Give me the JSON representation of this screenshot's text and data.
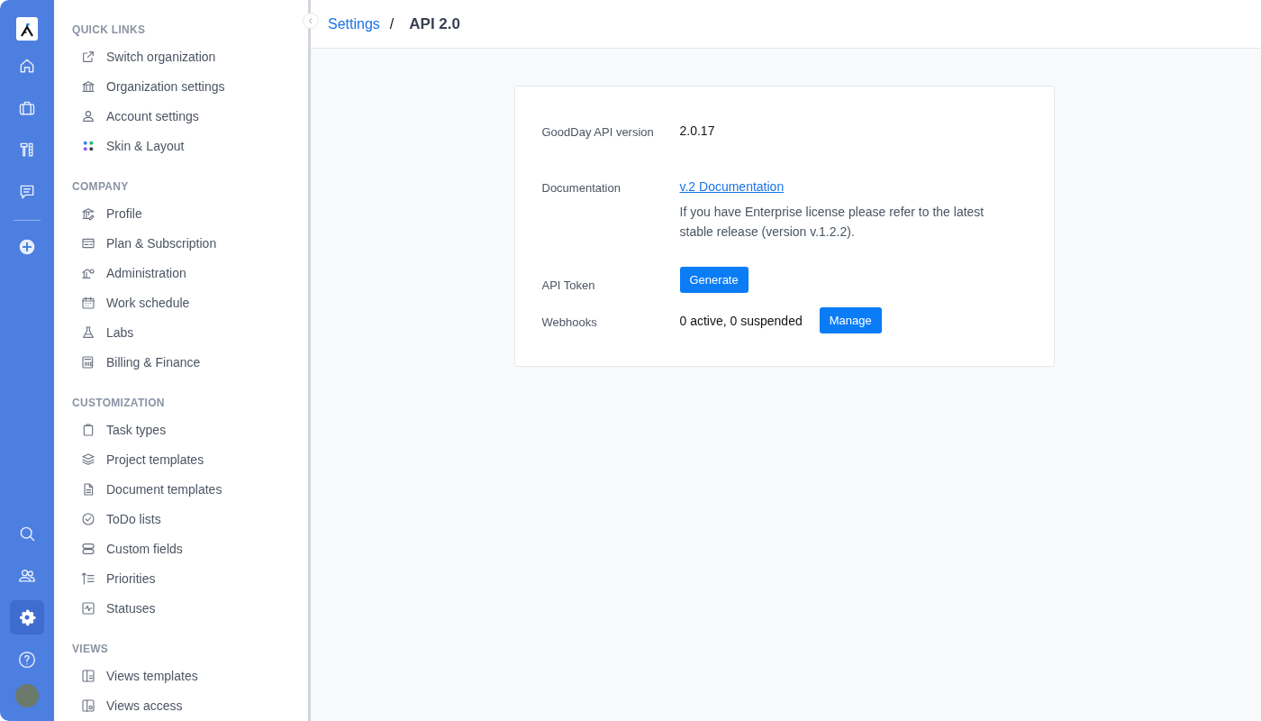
{
  "rail": {
    "top": [
      {
        "selected": false
      },
      {
        "selected": false
      },
      {
        "selected": false
      },
      {
        "selected": false
      }
    ],
    "add": {
      "selected": false
    },
    "bottom": [
      {
        "selected": false
      },
      {
        "selected": false
      },
      {
        "selected": true
      },
      {
        "selected": false
      }
    ]
  },
  "sidebar": {
    "sections": [
      {
        "title": "QUICK LINKS",
        "items": [
          {
            "label": "Switch organization"
          },
          {
            "label": "Organization settings"
          },
          {
            "label": "Account settings"
          },
          {
            "label": "Skin & Layout"
          }
        ]
      },
      {
        "title": "COMPANY",
        "items": [
          {
            "label": "Profile"
          },
          {
            "label": "Plan & Subscription"
          },
          {
            "label": "Administration"
          },
          {
            "label": "Work schedule"
          },
          {
            "label": "Labs"
          },
          {
            "label": "Billing & Finance"
          }
        ]
      },
      {
        "title": "CUSTOMIZATION",
        "items": [
          {
            "label": "Task types"
          },
          {
            "label": "Project templates"
          },
          {
            "label": "Document templates"
          },
          {
            "label": "ToDo lists"
          },
          {
            "label": "Custom fields"
          },
          {
            "label": "Priorities"
          },
          {
            "label": "Statuses"
          }
        ]
      },
      {
        "title": "VIEWS",
        "items": [
          {
            "label": "Views templates"
          },
          {
            "label": "Views access"
          }
        ]
      }
    ]
  },
  "breadcrumb": {
    "parent": "Settings",
    "separator": "/",
    "current": "API 2.0"
  },
  "card": {
    "rows": [
      {
        "kind": "text",
        "label": "GoodDay API version",
        "value": "2.0.17"
      },
      {
        "kind": "link",
        "label": "Documentation",
        "link": "v.2 Documentation",
        "note": "If you have Enterprise license please refer to the latest stable release (version v.1.2.2)."
      },
      {
        "kind": "button",
        "label": "API Token",
        "button": "Generate"
      },
      {
        "kind": "text_button",
        "label": "Webhooks",
        "value": "0 active, 0 suspended",
        "button": "Manage"
      }
    ]
  }
}
